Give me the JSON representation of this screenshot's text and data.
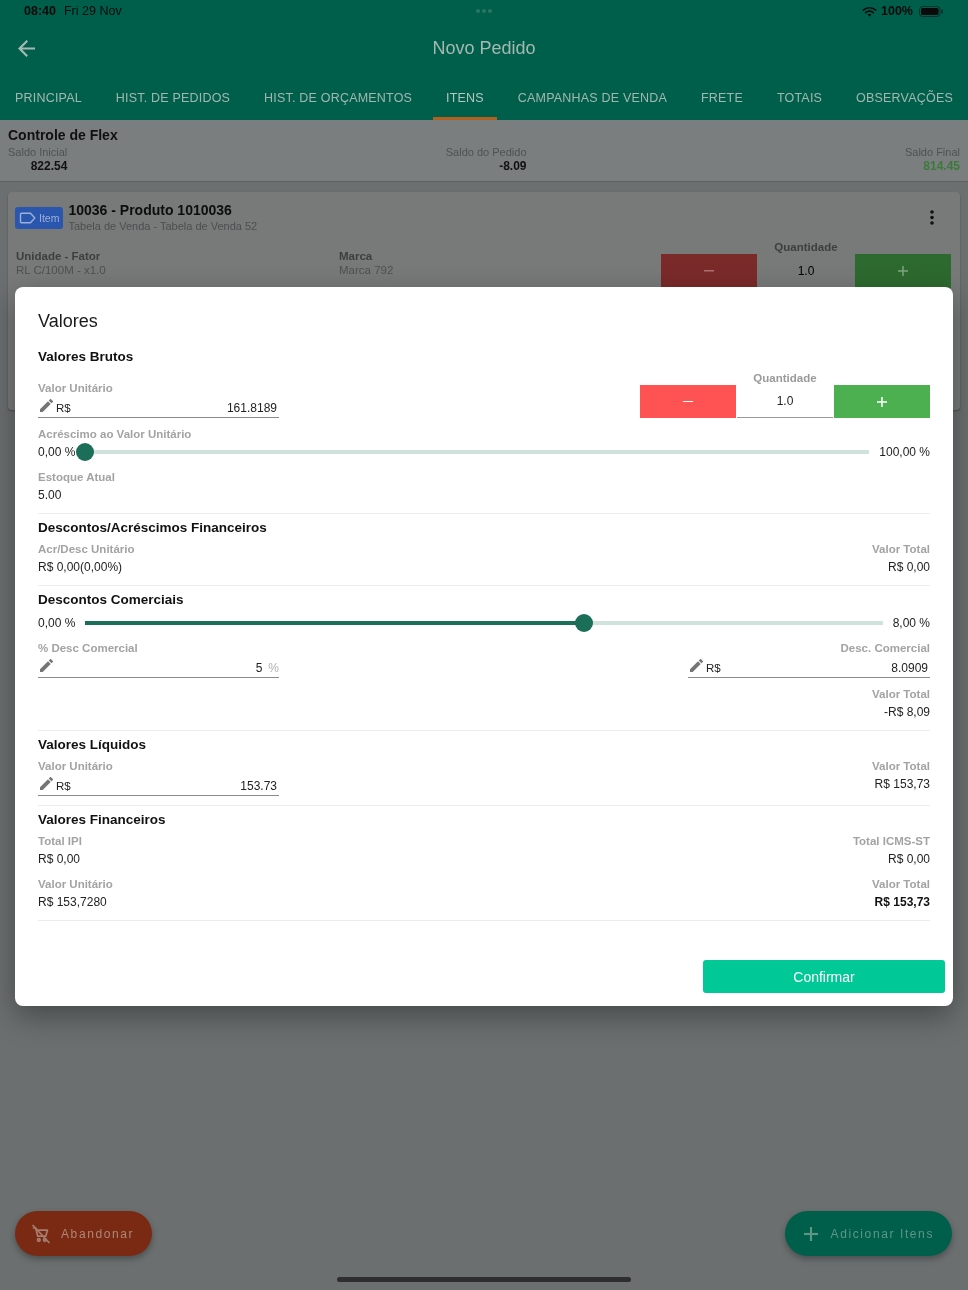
{
  "status_bar": {
    "time": "08:40",
    "date": "Fri 29 Nov",
    "battery": "100%"
  },
  "header": {
    "title": "Novo Pedido"
  },
  "tabs": [
    {
      "label": "PRINCIPAL",
      "selected": false
    },
    {
      "label": "HIST. DE PEDIDOS",
      "selected": false
    },
    {
      "label": "HIST. DE ORÇAMENTOS",
      "selected": false
    },
    {
      "label": "ITENS",
      "selected": true
    },
    {
      "label": "CAMPANHAS DE VENDA",
      "selected": false
    },
    {
      "label": "FRETE",
      "selected": false
    },
    {
      "label": "TOTAIS",
      "selected": false
    },
    {
      "label": "OBSERVAÇÕES",
      "selected": false
    }
  ],
  "flex_control": {
    "title": "Controle de Flex",
    "balances": [
      {
        "label": "Saldo Inicial",
        "value": "822.54",
        "kind": "plain"
      },
      {
        "label": "Saldo do Pedido",
        "value": "-8.09",
        "kind": "plain"
      },
      {
        "label": "Saldo Final",
        "value": "814.45",
        "kind": "positive"
      }
    ]
  },
  "item_card": {
    "badge": "Item",
    "title": "10036 - Produto 1010036",
    "subtitle": "Tabela de Venda - Tabela de Venda 52",
    "fields": [
      {
        "label": "Unidade - Fator",
        "value": "RL C/100M - x1.0"
      },
      {
        "label": "Marca",
        "value": "Marca 792"
      }
    ],
    "quantity": {
      "label": "Quantidade",
      "value": "1.0"
    }
  },
  "modal": {
    "title": "Valores",
    "sections": [
      {
        "title": "Valores Brutos",
        "rows": [
          {
            "kind": "pair",
            "left": {
              "kind": "field",
              "label": "Valor Unitário",
              "prefix": "R$",
              "value": "161.8189"
            },
            "right": {
              "kind": "stepper",
              "label": "Quantidade",
              "value": "1.0"
            }
          },
          {
            "kind": "slider",
            "label": "Acréscimo ao Valor Unitário",
            "min": "0,00 %",
            "max": "100,00 %",
            "level": 0
          },
          {
            "kind": "pair",
            "left": {
              "kind": "text",
              "label": "Estoque Atual",
              "value": "5.00"
            }
          }
        ]
      },
      {
        "title": "Descontos/Acréscimos Financeiros",
        "rows": [
          {
            "kind": "pair",
            "left": {
              "kind": "text",
              "label": "Acr/Desc Unitário",
              "value": "R$ 0,00(0,00%)"
            },
            "right": {
              "kind": "text",
              "label": "Valor Total",
              "value": "R$ 0,00"
            }
          }
        ]
      },
      {
        "title": "Descontos Comerciais",
        "rows": [
          {
            "kind": "slider",
            "min": "0,00 %",
            "max": "8,00 %",
            "level": 0.625
          },
          {
            "kind": "pair",
            "left": {
              "kind": "field",
              "label": "% Desc Comercial",
              "value": "5",
              "suffix": "%"
            },
            "right": {
              "kind": "field",
              "label": "Desc. Comercial",
              "prefix": "R$",
              "value": "8.0909"
            }
          },
          {
            "kind": "pair",
            "right": {
              "kind": "text",
              "label": "Valor Total",
              "value": "-R$ 8,09"
            }
          }
        ]
      },
      {
        "title": "Valores Líquidos",
        "rows": [
          {
            "kind": "pair",
            "left": {
              "kind": "field",
              "label": "Valor Unitário",
              "prefix": "R$",
              "value": "153.73"
            },
            "right": {
              "kind": "text",
              "label": "Valor Total",
              "value": "R$ 153,73"
            }
          }
        ]
      },
      {
        "title": "Valores Financeiros",
        "rows": [
          {
            "kind": "pair",
            "left": {
              "kind": "text",
              "label": "Total IPI",
              "value": "R$ 0,00"
            },
            "right": {
              "kind": "text",
              "label": "Total ICMS-ST",
              "value": "R$ 0,00"
            }
          },
          {
            "kind": "pair",
            "left": {
              "kind": "text",
              "label": "Valor Unitário",
              "value": "R$ 153,7280"
            },
            "right": {
              "kind": "text",
              "label": "Valor Total",
              "value": "R$ 153,73",
              "bold": true
            }
          }
        ]
      }
    ],
    "confirm_button": "Confirmar"
  },
  "actions": [
    {
      "label": "Abandonar",
      "kind": "abandon"
    },
    {
      "label": "Adicionar Itens",
      "kind": "add"
    }
  ]
}
